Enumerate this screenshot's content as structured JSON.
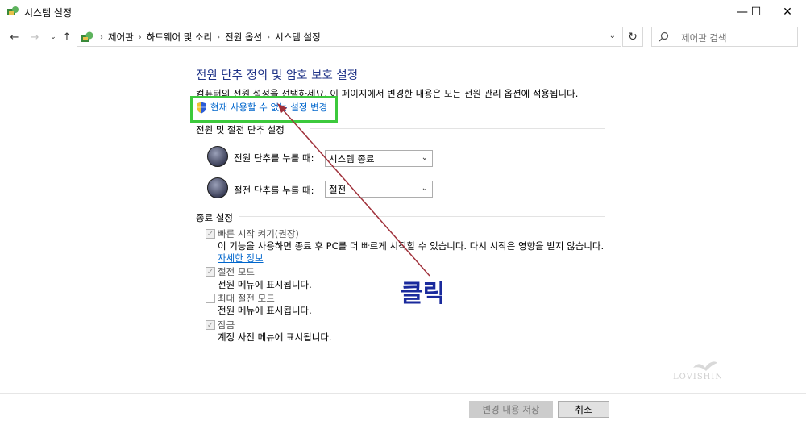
{
  "window": {
    "title": "시스템 설정",
    "controls": {
      "minimize": "—",
      "maximize": "☐",
      "close": "✕"
    }
  },
  "addressbar": {
    "breadcrumbs": [
      "제어판",
      "하드웨어 및 소리",
      "전원 옵션",
      "시스템 설정"
    ],
    "search_placeholder": "제어판 검색"
  },
  "main": {
    "title": "전원 단추 정의 및 암호 보호 설정",
    "description": "컴퓨터의 전원 설정을 선택하세요. 이 페이지에서 변경한 내용은 모든 전원 관리 옵션에 적용됩니다.",
    "change_link": "현재 사용할 수 없는 설정 변경"
  },
  "power_section": {
    "heading": "전원 및 절전 단추 설정",
    "rows": [
      {
        "label": "전원 단추를 누를 때:",
        "value": "시스템 종료"
      },
      {
        "label": "절전 단추를 누를 때:",
        "value": "절전"
      }
    ]
  },
  "shutdown_section": {
    "heading": "종료 설정",
    "items": [
      {
        "label": "빠른 시작 켜기(권장)",
        "checked": true,
        "desc": "이 기능을 사용하면 종료 후 PC를 더 빠르게 시작할 수 있습니다. 다시 시작은 영향을 받지 않습니다.",
        "link": "자세한 정보"
      },
      {
        "label": "절전 모드",
        "checked": true,
        "desc": "전원 메뉴에 표시됩니다."
      },
      {
        "label": "최대 절전 모드",
        "checked": false,
        "desc": "전원 메뉴에 표시됩니다."
      },
      {
        "label": "잠금",
        "checked": true,
        "desc": "계정 사진 메뉴에 표시됩니다."
      }
    ]
  },
  "annotation": {
    "text": "클릭"
  },
  "watermark": {
    "text": "LOVISHIN"
  },
  "footer": {
    "save_label": "변경 내용 저장",
    "cancel_label": "취소"
  },
  "colors": {
    "title_blue": "#1e3287",
    "link_blue": "#0066cc",
    "highlight_green": "#3cc93c",
    "arrow_red": "#a0303a",
    "annotation_blue": "#1a2a9c"
  }
}
